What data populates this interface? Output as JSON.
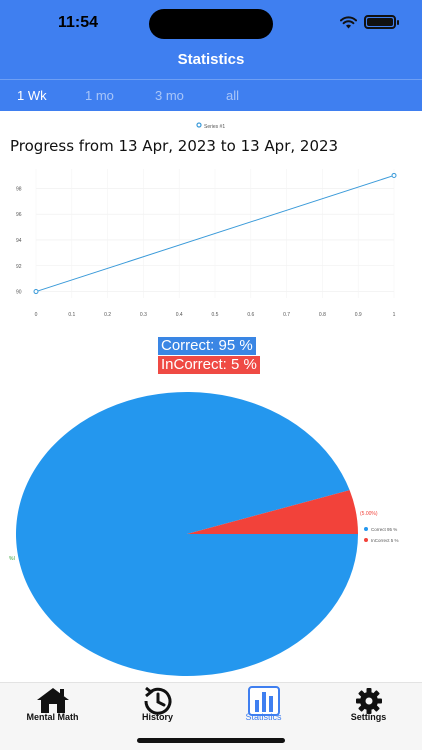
{
  "status_bar": {
    "time": "11:54"
  },
  "nav": {
    "title": "Statistics"
  },
  "period_tabs": [
    {
      "label": "1 Wk",
      "active": true
    },
    {
      "label": "1 mo",
      "active": false
    },
    {
      "label": "3 mo",
      "active": false
    },
    {
      "label": "all",
      "active": false
    }
  ],
  "line_chart": {
    "title": "Progress from 13 Apr, 2023 to 13 Apr, 2023",
    "legend": "Series #1",
    "color": "#3a9ad9"
  },
  "pie_chart": {
    "correct_label": "Correct: 95 %",
    "incorrect_label": "InCorrect: 5 %",
    "slice_value_label": "(5.00%)",
    "slice_value_label_other": "%I",
    "correct_color": "#2497ee",
    "incorrect_color": "#f2423a",
    "legend": [
      {
        "label": "Correct 95 %",
        "color": "#2497ee"
      },
      {
        "label": "InCorrect 5 %",
        "color": "#f2423a"
      }
    ]
  },
  "chart_data": [
    {
      "type": "line",
      "title": "Progress from 13 Apr, 2023 to 13 Apr, 2023",
      "series": [
        {
          "name": "Series #1",
          "x": [
            0,
            1
          ],
          "values": [
            90,
            99
          ]
        }
      ],
      "x_ticks": [
        "0",
        "0.1",
        "0.2",
        "0.3",
        "0.4",
        "0.5",
        "0.6",
        "0.7",
        "0.8",
        "0.9",
        "1"
      ],
      "y_ticks": [
        "90",
        "92",
        "94",
        "96",
        "98"
      ],
      "xlim": [
        0,
        1
      ],
      "ylim": [
        89.5,
        99.5
      ],
      "grid": true,
      "legend_position": "top"
    },
    {
      "type": "pie",
      "categories": [
        "Correct 95 %",
        "InCorrect 5 %"
      ],
      "values": [
        95,
        5
      ],
      "legend_position": "right"
    }
  ],
  "tabbar": {
    "items": [
      {
        "label": "Mental Math",
        "icon": "house-icon"
      },
      {
        "label": "History",
        "icon": "clock-history-icon"
      },
      {
        "label": "Statistics",
        "icon": "bar-chart-icon"
      },
      {
        "label": "Settings",
        "icon": "gear-icon"
      }
    ]
  }
}
